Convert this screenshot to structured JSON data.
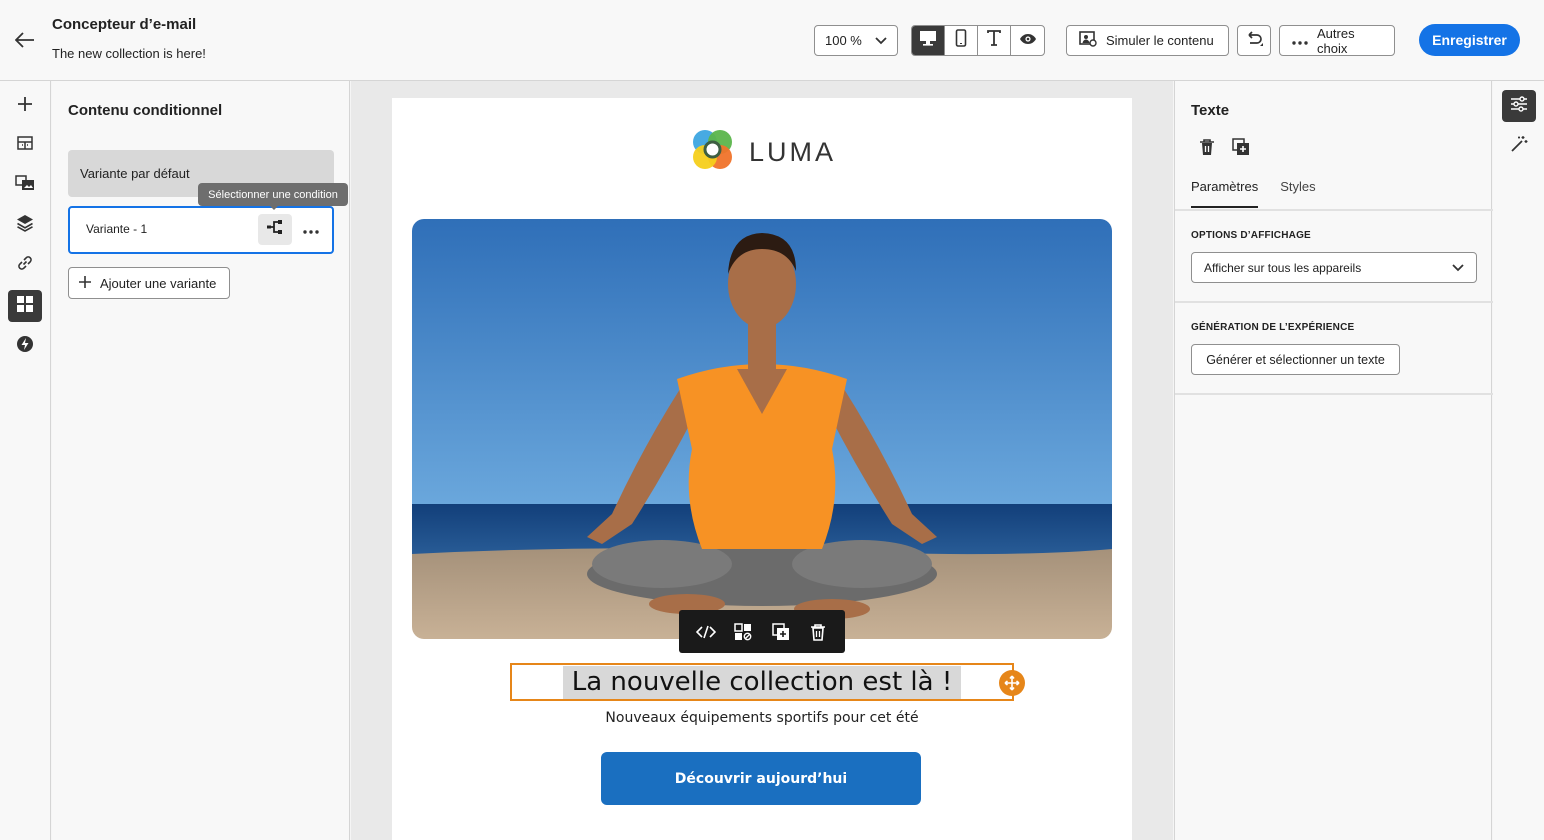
{
  "header": {
    "title": "Concepteur d’e-mail",
    "subtitle": "The new collection is here!",
    "zoom": "100 %",
    "simulate_label": "Simuler le contenu",
    "more_label": "Autres choix",
    "save_label": "Enregistrer"
  },
  "left_panel": {
    "title": "Contenu conditionnel",
    "default_variant": "Variante par défaut",
    "variant_1": "Variante - 1",
    "tooltip": "Sélectionner une condition",
    "add_variant": "Ajouter une variante"
  },
  "email": {
    "logo_text": "LUMA",
    "headline": "La nouvelle collection est là !",
    "subline": "Nouveaux équipements sportifs pour cet été",
    "cta": "Découvrir aujourd’hui"
  },
  "right_panel": {
    "title": "Texte",
    "tabs": [
      "Paramètres",
      "Styles"
    ],
    "display_options_label": "OPTIONS D’AFFICHAGE",
    "display_select_value": "Afficher sur tous les appareils",
    "experience_label": "GÉNÉRATION DE L’EXPÉRIENCE",
    "generate_button": "Générer et sélectionner un texte"
  },
  "colors": {
    "accent": "#1473e6",
    "selection": "#e68619",
    "cta": "#1a6fc0"
  }
}
